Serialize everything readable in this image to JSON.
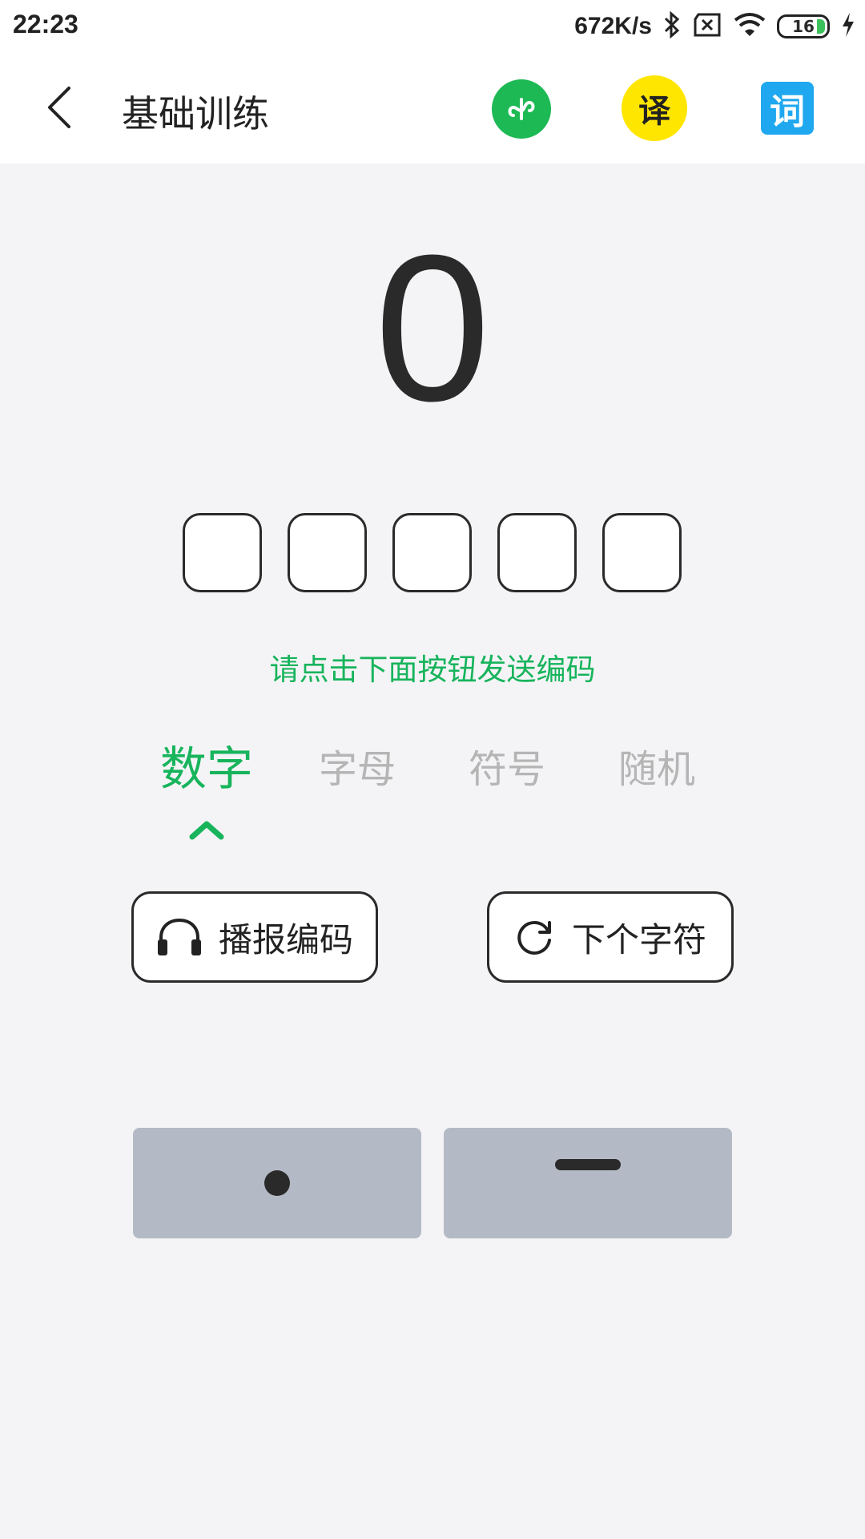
{
  "status_bar": {
    "time": "22:23",
    "net_speed": "672K/s",
    "battery_level": "16",
    "icons": [
      "bluetooth-icon",
      "sim-off-icon",
      "wifi-icon",
      "battery-icon",
      "charging-icon"
    ]
  },
  "app_bar": {
    "title": "基础训练",
    "back_icon": "chevron-left-icon",
    "translate_label": "译",
    "dict_label": "词",
    "mini_program_icon": "mini-program-icon",
    "colors": {
      "mini_program": "#1db954",
      "translate": "#ffe600",
      "dict": "#1fa8ef"
    }
  },
  "main": {
    "current_char": "0",
    "code_slots": [
      "",
      "",
      "",
      "",
      ""
    ],
    "hint": "请点击下面按钮发送编码"
  },
  "tabs": [
    {
      "label": "数字",
      "active": true
    },
    {
      "label": "字母",
      "active": false
    },
    {
      "label": "符号",
      "active": false
    },
    {
      "label": "随机",
      "active": false
    }
  ],
  "actions": {
    "play_label": "播报编码",
    "next_label": "下个字符"
  },
  "keys": {
    "dot_icon": "dot-icon",
    "dash_icon": "dash-icon"
  },
  "colors": {
    "accent": "#17b45c",
    "key_bg": "#b4bac5",
    "page_bg": "#f4f4f6"
  }
}
